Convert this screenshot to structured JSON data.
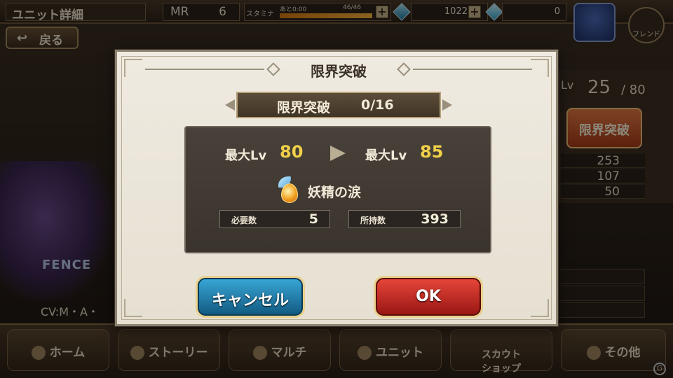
{
  "header": {
    "title": "ユニット詳細",
    "mr_label": "MR",
    "mr_value": "6",
    "stamina_label": "スタミナ",
    "stamina_remaining": "あと0:00",
    "stamina_value": "46/46",
    "stamina_fraction": 1.0,
    "gems": "1022",
    "crystals": "0",
    "friend_label": "フレンド"
  },
  "back_button": "戻る",
  "side": {
    "lv_label": "Lv",
    "lv_value": "25",
    "lv_max": "/ 80",
    "limit_button": "限界突破",
    "stats": [
      "253",
      "107",
      "50"
    ]
  },
  "character": {
    "class_text": "FENCE",
    "cv_text": "CV:M・A・"
  },
  "dialog": {
    "title": "限界突破",
    "banner_label": "限界突破",
    "banner_value": "0/16",
    "max_lv_label": "最大Lv",
    "from_lv": "80",
    "to_lv": "85",
    "item_name": "妖精の涙",
    "required_label": "必要数",
    "required_value": "5",
    "owned_label": "所持数",
    "owned_value": "393",
    "cancel_label": "キャンセル",
    "ok_label": "OK"
  },
  "nav": [
    {
      "label": "ホーム",
      "icon": "castle-icon"
    },
    {
      "label": "ストーリー",
      "icon": "sword-icon"
    },
    {
      "label": "マルチ",
      "icon": "party-icon"
    },
    {
      "label": "ユニット",
      "icon": "armor-icon"
    },
    {
      "label": "スカウト\nショップ",
      "icon": "shop-icon"
    },
    {
      "label": "その他",
      "icon": "gear-icon"
    }
  ],
  "colors": {
    "cancel": "#1d7fb0",
    "ok": "#c92a22",
    "lv_highlight": "#f0d04a"
  }
}
